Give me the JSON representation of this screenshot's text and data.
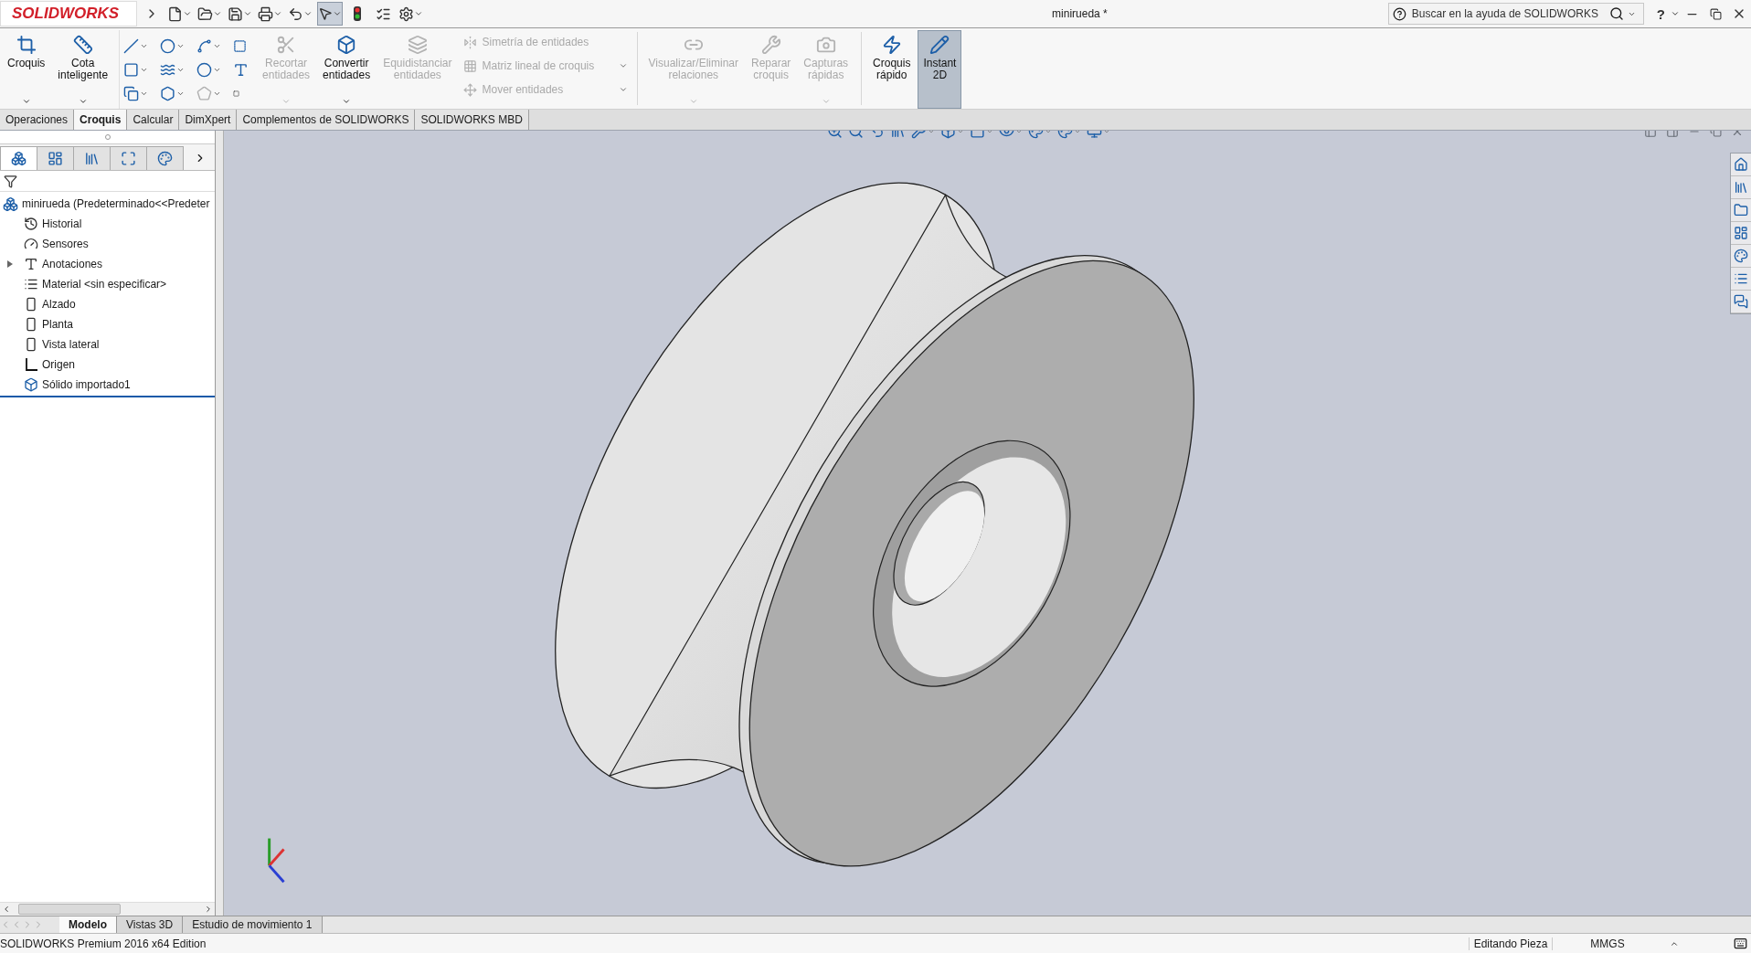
{
  "titlebar": {
    "logo": "SOLIDWORKS",
    "document_title": "minirueda *",
    "help_search": {
      "placeholder": "Buscar en la ayuda de SOLIDWORKS"
    },
    "help": "?"
  },
  "ribbon": [
    {
      "kind": "large",
      "label": "Croquis",
      "disabled": false,
      "selected": false,
      "dropdown": true
    },
    {
      "kind": "large",
      "label": "Cota inteligente",
      "disabled": false,
      "selected": false,
      "dropdown": true
    },
    {
      "kind": "tool_grid"
    },
    {
      "kind": "large",
      "label": "Recortar entidades",
      "disabled": true,
      "selected": false,
      "dropdown": true
    },
    {
      "kind": "large",
      "label": "Convertir entidades",
      "disabled": false,
      "selected": false,
      "dropdown": true
    },
    {
      "kind": "large",
      "label": "Equidistanciar entidades",
      "disabled": true,
      "selected": false,
      "dropdown": false
    },
    {
      "kind": "small_column",
      "items": [
        {
          "label": "Simetría de entidades",
          "disabled": true,
          "dropdown": false
        },
        {
          "label": "Matriz lineal de croquis",
          "disabled": true,
          "dropdown": true
        },
        {
          "label": "Mover entidades",
          "disabled": true,
          "dropdown": true
        }
      ]
    },
    {
      "kind": "separator"
    },
    {
      "kind": "large",
      "label": "Visualizar/Eliminar relaciones",
      "disabled": true,
      "selected": false,
      "dropdown": true
    },
    {
      "kind": "large",
      "label": "Reparar croquis",
      "disabled": true,
      "selected": false,
      "dropdown": false
    },
    {
      "kind": "large",
      "label": "Capturas rápidas",
      "disabled": true,
      "selected": false,
      "dropdown": true
    },
    {
      "kind": "separator"
    },
    {
      "kind": "large",
      "label": "Croquis rápido",
      "disabled": false,
      "selected": false,
      "dropdown": false
    },
    {
      "kind": "large",
      "label": "Instant 2D",
      "disabled": false,
      "selected": true,
      "dropdown": false
    }
  ],
  "command_tabs": [
    {
      "label": "Operaciones",
      "selected": false
    },
    {
      "label": "Croquis",
      "selected": true
    },
    {
      "label": "Calcular",
      "selected": false
    },
    {
      "label": "DimXpert",
      "selected": false
    },
    {
      "label": "Complementos de SOLIDWORKS",
      "selected": false
    },
    {
      "label": "SOLIDWORKS MBD",
      "selected": false
    }
  ],
  "feature_tree": {
    "root": "minirueda  (Predeterminado<<Predeter",
    "items": [
      {
        "kind": "history",
        "label": "Historial",
        "expandable": false
      },
      {
        "kind": "sensors",
        "label": "Sensores",
        "expandable": false
      },
      {
        "kind": "annotations",
        "label": "Anotaciones",
        "expandable": true
      },
      {
        "kind": "material",
        "label": "Material <sin especificar>",
        "expandable": false
      },
      {
        "kind": "plane",
        "label": "Alzado",
        "expandable": false
      },
      {
        "kind": "plane",
        "label": "Planta",
        "expandable": false
      },
      {
        "kind": "plane",
        "label": "Vista lateral",
        "expandable": false
      },
      {
        "kind": "origin",
        "label": "Origen",
        "expandable": false
      },
      {
        "kind": "solid",
        "label": "Sólido importado1",
        "expandable": false
      }
    ]
  },
  "model_tabs": [
    {
      "label": "Modelo",
      "selected": true
    },
    {
      "label": "Vistas 3D",
      "selected": false
    },
    {
      "label": "Estudio de movimiento 1",
      "selected": false
    }
  ],
  "status_bar": {
    "edition": "SOLIDWORKS Premium 2016 x64 Edition",
    "mode": "Editando Pieza",
    "units": "MMGS"
  }
}
